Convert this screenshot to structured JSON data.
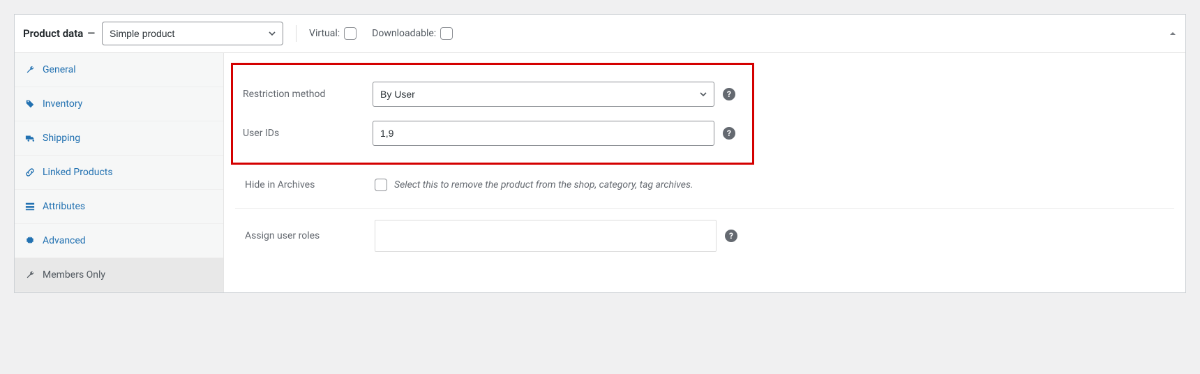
{
  "header": {
    "title": "Product data",
    "separator": "—",
    "product_type": "Simple product",
    "virtual_label": "Virtual:",
    "downloadable_label": "Downloadable:"
  },
  "tabs": [
    {
      "label": "General",
      "icon": "wrench-icon"
    },
    {
      "label": "Inventory",
      "icon": "tag-icon"
    },
    {
      "label": "Shipping",
      "icon": "truck-icon"
    },
    {
      "label": "Linked Products",
      "icon": "link-icon"
    },
    {
      "label": "Attributes",
      "icon": "list-icon"
    },
    {
      "label": "Advanced",
      "icon": "gear-icon"
    },
    {
      "label": "Members Only",
      "icon": "wrench-icon"
    }
  ],
  "form": {
    "restriction_method": {
      "label": "Restriction method",
      "value": "By User"
    },
    "user_ids": {
      "label": "User IDs",
      "value": "1,9"
    },
    "hide_archives": {
      "label": "Hide in Archives",
      "desc": "Select this to remove the product from the shop, category, tag archives."
    },
    "assign_roles": {
      "label": "Assign user roles"
    }
  },
  "help_glyph": "?"
}
